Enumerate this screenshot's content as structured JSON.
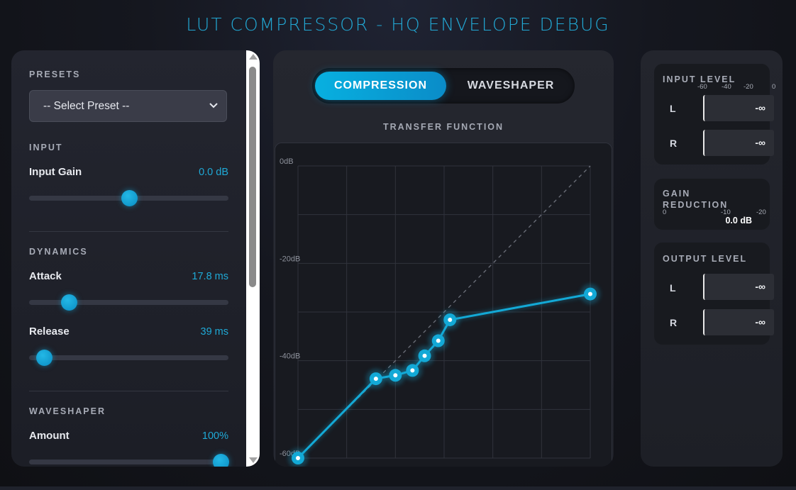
{
  "app": {
    "title": "LUT COMPRESSOR - HQ ENVELOPE DEBUG"
  },
  "left": {
    "presets": {
      "title": "PRESETS",
      "selected": "-- Select Preset --"
    },
    "input": {
      "title": "INPUT",
      "gain": {
        "label": "Input Gain",
        "value": "0.0 dB",
        "position": 0.5
      }
    },
    "dynamics": {
      "title": "DYNAMICS",
      "attack": {
        "label": "Attack",
        "value": "17.8 ms",
        "position": 0.2
      },
      "release": {
        "label": "Release",
        "value": "39 ms",
        "position": 0.07
      }
    },
    "waveshaper": {
      "title": "WAVESHAPER",
      "amount": {
        "label": "Amount",
        "value": "100%",
        "position": 1.0
      }
    }
  },
  "center": {
    "tabs": {
      "compression": "COMPRESSION",
      "waveshaper": "WAVESHAPER",
      "active": "compression"
    },
    "transfer_title": "TRANSFER FUNCTION"
  },
  "chart_data": {
    "type": "line",
    "title": "TRANSFER FUNCTION",
    "y_tick_labels": [
      "0dB",
      "-20dB",
      "-40dB",
      "-60dB"
    ],
    "xlim": [
      -60,
      0
    ],
    "ylim": [
      -60,
      0
    ],
    "grid": true,
    "reference_line": "unity (dashed diagonal)",
    "line_color": "#13a9d6",
    "series": [
      {
        "x": [
          -60,
          -44,
          -40,
          -36.5,
          -34,
          -31.2,
          -28.8,
          0
        ],
        "y": [
          -60,
          -43.7,
          -43,
          -42,
          -39,
          -35.9,
          -31.6,
          -26.3
        ]
      }
    ]
  },
  "right": {
    "input_level": {
      "title": "INPUT LEVEL",
      "scale": [
        "-60",
        "-40",
        "-20",
        "0"
      ],
      "channels": [
        {
          "label": "L",
          "value": "-∞"
        },
        {
          "label": "R",
          "value": "-∞"
        }
      ]
    },
    "gain_reduction": {
      "title_line1": "GAIN",
      "title_line2": "REDUCTION",
      "scale": [
        "0",
        "-10",
        "-20"
      ],
      "value": "0.0 dB"
    },
    "output_level": {
      "title": "OUTPUT LEVEL",
      "channels": [
        {
          "label": "L",
          "value": "-∞"
        },
        {
          "label": "R",
          "value": "-∞"
        }
      ]
    }
  },
  "colors": {
    "accent": "#13a9d6",
    "background": "#15171f",
    "panel": "#23252f"
  }
}
